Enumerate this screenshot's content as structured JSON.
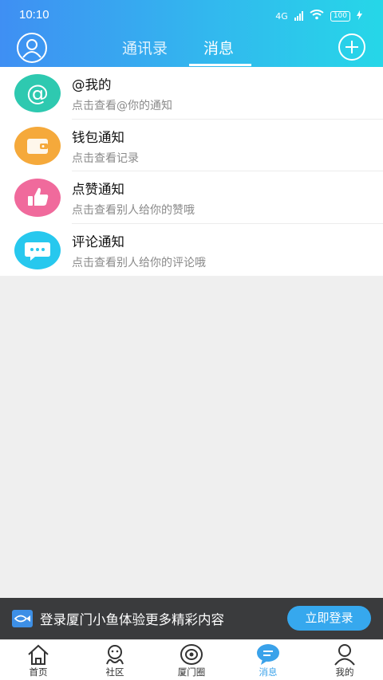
{
  "status_bar": {
    "time": "10:10",
    "battery": "100",
    "network": "4G"
  },
  "header": {
    "tabs": [
      {
        "label": "通讯录",
        "active": false
      },
      {
        "label": "消息",
        "active": true
      }
    ]
  },
  "notifications": [
    {
      "title": "@我的",
      "subtitle": "点击查看@你的通知",
      "icon": "at-icon",
      "color": "#2ec9b0"
    },
    {
      "title": "钱包通知",
      "subtitle": "点击查看记录",
      "icon": "wallet-icon",
      "color": "#f5a93b"
    },
    {
      "title": "点赞通知",
      "subtitle": "点击查看别人给你的赞哦",
      "icon": "thumbs-up-icon",
      "color": "#f06a9c"
    },
    {
      "title": "评论通知",
      "subtitle": "点击查看别人给你的评论哦",
      "icon": "comment-icon",
      "color": "#27c8ee"
    }
  ],
  "login_banner": {
    "text": "登录厦门小鱼体验更多精彩内容",
    "button": "立即登录"
  },
  "bottom_nav": [
    {
      "label": "首页",
      "icon": "home-icon",
      "active": false
    },
    {
      "label": "社区",
      "icon": "community-icon",
      "active": false
    },
    {
      "label": "厦门圈",
      "icon": "circle-icon",
      "active": false
    },
    {
      "label": "消息",
      "icon": "message-icon",
      "active": true
    },
    {
      "label": "我的",
      "icon": "profile-icon",
      "active": false
    }
  ],
  "colors": {
    "accent": "#36a8ee",
    "header_start": "#3f8ff3",
    "header_end": "#26d7e8"
  }
}
